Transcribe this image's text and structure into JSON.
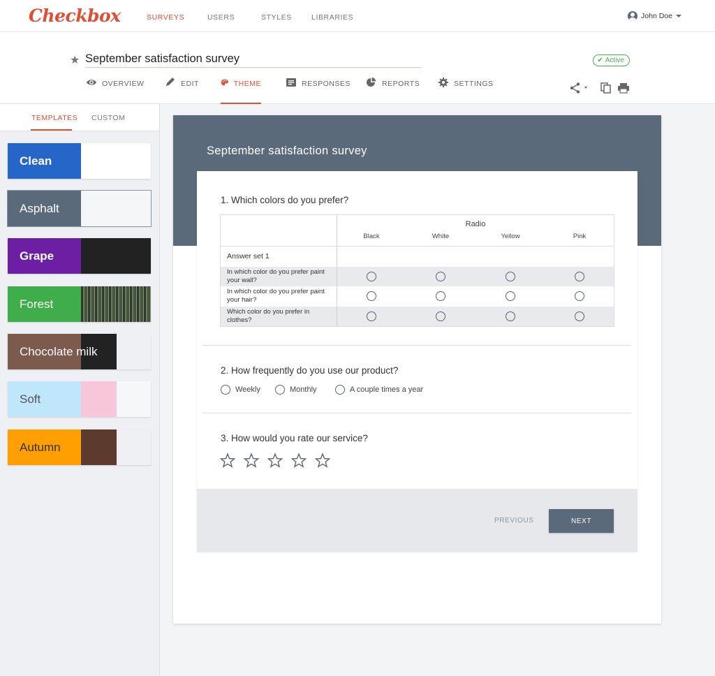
{
  "topnav": {
    "logo": "Checkbox",
    "links": [
      "SURVEYS",
      "USERS",
      "STYLES",
      "LIBRARIES"
    ],
    "user": "John Doe"
  },
  "survey": {
    "title": "September satisfaction survey",
    "status": "Active",
    "tabs": [
      "OVERVIEW",
      "EDIT",
      "THEME",
      "RESPONSES",
      "REPORTS",
      "SETTINGS"
    ],
    "active_tab": "THEME"
  },
  "left": {
    "tabs": [
      "TEMPLATES",
      "CUSTOM"
    ],
    "active_tab": "TEMPLATES",
    "themes": [
      {
        "name": "Clean",
        "colors": [
          "#2566c8",
          "#ffffff",
          "#ffffff"
        ],
        "text": "#ffffff",
        "bold": true
      },
      {
        "name": "Asphalt",
        "colors": [
          "#5a6a7a",
          "#f5f6f8",
          "#f5f6f8"
        ],
        "text": "#ffffff",
        "bold": false
      },
      {
        "name": "Grape",
        "colors": [
          "#6c1fa2",
          "#222222",
          "#222222"
        ],
        "text": "#ffffff",
        "bold": true
      },
      {
        "name": "Forest",
        "colors": [
          "#3fae4a",
          "#3a4a3a",
          "#5a6a50"
        ],
        "text": "#ffffff",
        "bold": false
      },
      {
        "name": "Chocolate milk",
        "colors": [
          "#7d5a4e",
          "#222222",
          "#eef0f3"
        ],
        "text": "#ffffff",
        "bold": false
      },
      {
        "name": "Soft",
        "colors": [
          "#bfe6fa",
          "#f7c6d9",
          "#f5f7f8"
        ],
        "text": "#555555",
        "bold": false
      },
      {
        "name": "Autumn",
        "colors": [
          "#ffa000",
          "#5c3a2e",
          "#eef0f3"
        ],
        "text": "#333333",
        "bold": false
      }
    ]
  },
  "preview": {
    "title": "September satisfaction survey",
    "q1": {
      "text": "1. Which colors do you prefer?",
      "matrix_header": "Radio",
      "columns": [
        "Black",
        "White",
        "Yellow",
        "Pink"
      ],
      "answer_set": "Answer set 1",
      "rows": [
        "In which color do you prefer paint your wall?",
        "In which color do you prefer paint your hair?",
        "Which color do you prefer in clothes?"
      ]
    },
    "q2": {
      "text": "2. How frequently do you use our product?",
      "options": [
        "Weekly",
        "Monthly",
        "A couple times a year"
      ]
    },
    "q3": {
      "text": "3. How would you rate our service?",
      "stars": 5
    },
    "previous": "PREVIOUS",
    "next": "NEXT"
  },
  "icons": {
    "star": "star-icon",
    "overview": "eye-icon",
    "edit": "pencil-icon",
    "theme": "palette-icon",
    "responses": "responses-icon",
    "reports": "pie-chart-icon",
    "settings": "gear-icon",
    "share": "share-icon",
    "copy": "copy-icon",
    "print": "print-icon"
  },
  "colors": {
    "accent": "#e04e36",
    "theme_primary": "#5a6a7a",
    "active_green": "#4caf50"
  }
}
